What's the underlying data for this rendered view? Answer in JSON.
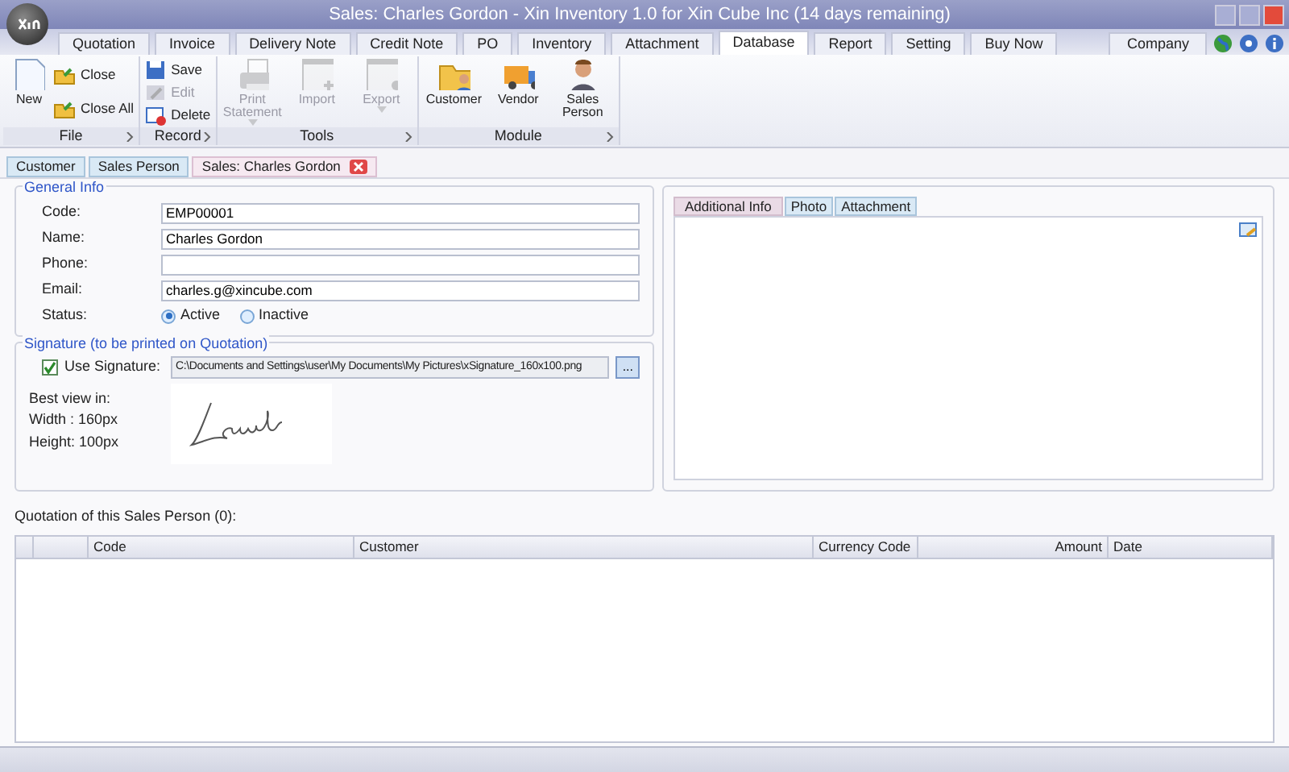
{
  "window": {
    "title": "Sales: Charles Gordon - Xin Inventory 1.0 for Xin Cube Inc (14 days remaining)"
  },
  "menu_tabs": [
    {
      "label": "Quotation",
      "selected": false
    },
    {
      "label": "Invoice",
      "selected": false
    },
    {
      "label": "Delivery Note",
      "selected": false
    },
    {
      "label": "Credit Note",
      "selected": false
    },
    {
      "label": "PO",
      "selected": false
    },
    {
      "label": "Inventory",
      "selected": false
    },
    {
      "label": "Attachment",
      "selected": false
    },
    {
      "label": "Database",
      "selected": true
    },
    {
      "label": "Report",
      "selected": false
    },
    {
      "label": "Setting",
      "selected": false
    },
    {
      "label": "Buy Now",
      "selected": false
    }
  ],
  "company_button": "Company",
  "ribbon_groups": [
    {
      "label": "File",
      "buttons": [
        {
          "label": "New",
          "kind": "large",
          "disabled": false
        },
        {
          "label": "Close",
          "kind": "small",
          "disabled": false
        },
        {
          "label": "Close All",
          "kind": "small",
          "disabled": false
        }
      ]
    },
    {
      "label": "Record",
      "buttons": [
        {
          "label": "Save",
          "kind": "small",
          "disabled": false
        },
        {
          "label": "Edit",
          "kind": "small",
          "disabled": true
        },
        {
          "label": "Delete",
          "kind": "small",
          "disabled": false
        }
      ]
    },
    {
      "label": "Tools",
      "buttons": [
        {
          "label": "Print Statement",
          "kind": "large",
          "disabled": true,
          "dropdown": true
        },
        {
          "label": "Import",
          "kind": "large",
          "disabled": true
        },
        {
          "label": "Export",
          "kind": "large",
          "disabled": true,
          "dropdown": true
        }
      ]
    },
    {
      "label": "Module",
      "buttons": [
        {
          "label": "Customer",
          "kind": "large",
          "disabled": false
        },
        {
          "label": "Vendor",
          "kind": "large",
          "disabled": false
        },
        {
          "label": "Sales Person",
          "kind": "large",
          "disabled": false
        }
      ]
    }
  ],
  "doc_tabs": [
    {
      "label": "Customer",
      "selected": false,
      "closable": false
    },
    {
      "label": "Sales Person",
      "selected": false,
      "closable": false
    },
    {
      "label": "Sales: Charles Gordon",
      "selected": true,
      "closable": true
    }
  ],
  "general_info": {
    "title": "General Info",
    "fields": [
      {
        "label": "Code:",
        "value": "EMP00001"
      },
      {
        "label": "Name:",
        "value": "Charles Gordon"
      },
      {
        "label": "Phone:"
      },
      {
        "label": "Email:",
        "value": "charles.g@xincube.com"
      }
    ],
    "status": {
      "label": "Status:",
      "options": [
        {
          "label": "Active",
          "selected": true
        },
        {
          "label": "Inactive",
          "selected": false
        }
      ]
    }
  },
  "signature": {
    "title": "Signature (to be printed on Quotation)",
    "use_signature": {
      "label": "Use Signature:",
      "checked": true
    },
    "path": "C:\\Documents and Settings\\user\\My Documents\\My Pictures\\xSignature_160x100.png",
    "browse_button": "...",
    "hints": [
      "Best view in:",
      "Width : 160px",
      "Height: 100px"
    ]
  },
  "detail_tabs": [
    {
      "label": "Additional Info",
      "selected": true
    },
    {
      "label": "Photo",
      "selected": false
    },
    {
      "label": "Attachment",
      "selected": false
    }
  ],
  "quotations": {
    "title": "Quotation of this Sales Person (0):",
    "columns": [
      {
        "label": "Code",
        "kind": "text"
      },
      {
        "label": "Customer",
        "kind": "text"
      },
      {
        "label": "Currency Code",
        "kind": "text"
      },
      {
        "label": "Amount",
        "kind": "number"
      },
      {
        "label": "Date",
        "kind": "date"
      }
    ]
  }
}
